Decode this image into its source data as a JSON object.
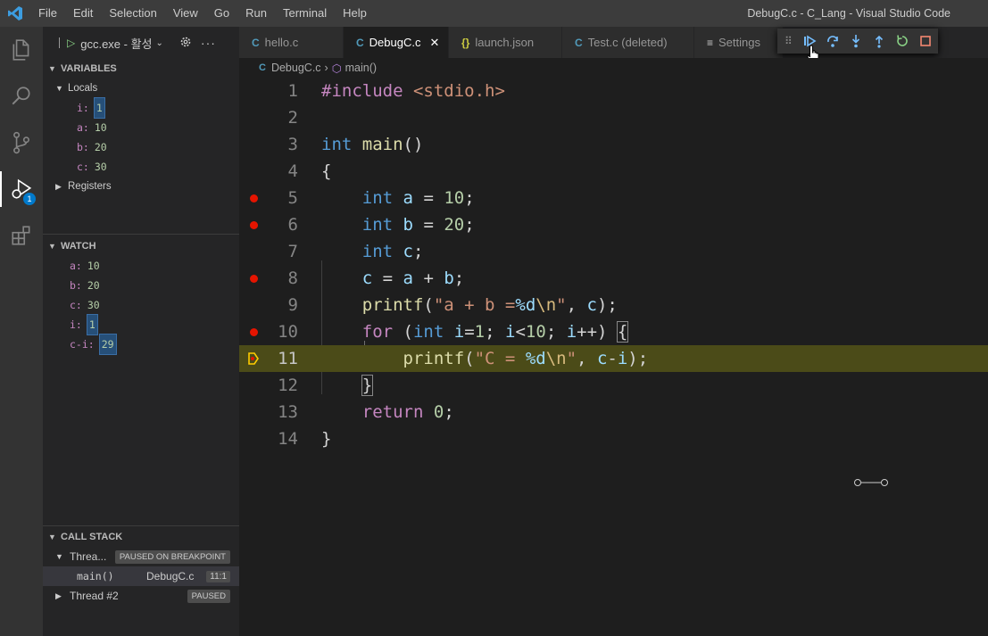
{
  "window": {
    "title": "DebugC.c - C_Lang - Visual Studio Code",
    "menu": [
      "File",
      "Edit",
      "Selection",
      "View",
      "Go",
      "Run",
      "Terminal",
      "Help"
    ]
  },
  "activity_bar": {
    "items": [
      "files-icon",
      "search-icon",
      "source-control-icon",
      "run-debug-icon",
      "extensions-icon"
    ],
    "debug_badge": "1"
  },
  "debug_toolbar": {
    "config_label": "gcc.exe - 활성"
  },
  "variables": {
    "section_title": "VARIABLES",
    "locals_label": "Locals",
    "locals": [
      {
        "name": "i:",
        "value": "1"
      },
      {
        "name": "a:",
        "value": "10"
      },
      {
        "name": "b:",
        "value": "20"
      },
      {
        "name": "c:",
        "value": "30"
      }
    ],
    "registers_label": "Registers"
  },
  "watch": {
    "section_title": "WATCH",
    "items": [
      {
        "name": "a:",
        "value": "10"
      },
      {
        "name": "b:",
        "value": "20"
      },
      {
        "name": "c:",
        "value": "30"
      },
      {
        "name": "i:",
        "value": "1"
      },
      {
        "name": "c-i:",
        "value": "29"
      }
    ]
  },
  "call_stack": {
    "section_title": "CALL STACK",
    "thread1_label": "Threa...",
    "thread1_status": "PAUSED ON BREAKPOINT",
    "frame_name": "main()",
    "frame_file": "DebugC.c",
    "frame_pos": "11:1",
    "thread2_label": "Thread #2",
    "thread2_status": "PAUSED"
  },
  "tabs": [
    {
      "icon": "C",
      "label": "hello.c"
    },
    {
      "icon": "C",
      "label": "DebugC.c"
    },
    {
      "icon": "{}",
      "label": "launch.json"
    },
    {
      "icon": "C",
      "label": "Test.c (deleted)"
    },
    {
      "icon": "≡",
      "label": "Settings"
    }
  ],
  "breadcrumb": {
    "file_icon": "C",
    "file": "DebugC.c",
    "symbol": "main()"
  },
  "editor": {
    "line_numbers": [
      "1",
      "2",
      "3",
      "4",
      "5",
      "6",
      "7",
      "8",
      "9",
      "10",
      "11",
      "12",
      "13",
      "14"
    ],
    "breakpoint_lines": [
      5,
      6,
      8,
      10
    ],
    "current_line": 11,
    "colors": {
      "breakpoint": "#e51400",
      "current_line_bg": "#4b4b18",
      "keyword": "#569cd6",
      "string": "#ce9178"
    }
  }
}
